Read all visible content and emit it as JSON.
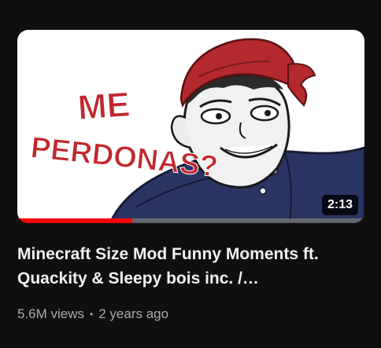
{
  "video": {
    "thumbnail_text": {
      "line1": "ME",
      "line2": "PERDONAS?"
    },
    "duration": "2:13",
    "watch_progress": 0.33,
    "title": "Minecraft Size Mod Funny Moments ft. Quackity & Sleepy bois inc. /…",
    "views": "5.6M views",
    "separator": "•",
    "age": "2 years ago"
  },
  "colors": {
    "background": "#0f0f0f",
    "progress": "#ff0000",
    "title": "#f1f1f1",
    "meta": "#aaaaaa",
    "thumb_text": "#c0282d"
  }
}
